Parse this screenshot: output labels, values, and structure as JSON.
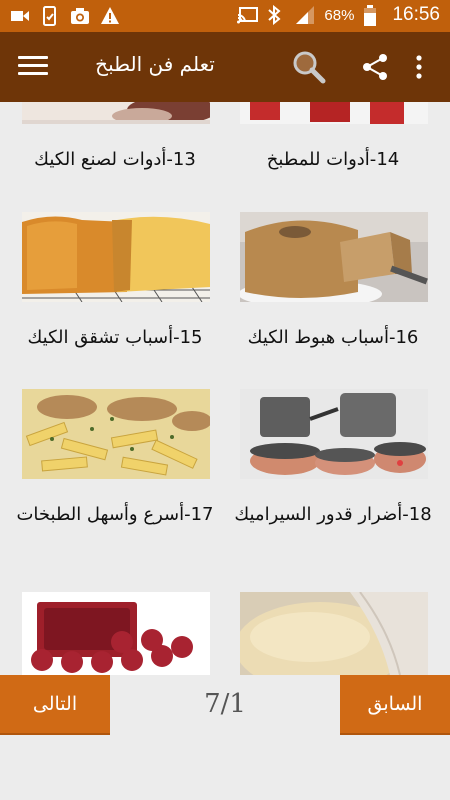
{
  "status_bar": {
    "battery_percent": "68%",
    "time": "16:56",
    "left_icons": [
      "video-icon",
      "phone-check-icon",
      "camera-icon",
      "warning-icon"
    ],
    "right_icons": [
      "cast-icon",
      "bluetooth-icon",
      "signal-icon",
      "battery-icon"
    ]
  },
  "app_bar": {
    "title": "تعلم فن الطبخ",
    "icons": [
      "menu-icon",
      "search-icon",
      "share-icon",
      "more-vert-icon"
    ]
  },
  "grid": {
    "items": [
      {
        "label": "13-أدوات لصنع الكيك"
      },
      {
        "label": "14-أدوات للمطبخ"
      },
      {
        "label": "15-أسباب تشقق الكيك"
      },
      {
        "label": "16-أسباب هبوط الكيك"
      },
      {
        "label": "17-أسرع وأسهل الطبخات"
      },
      {
        "label": "18-أضرار قدور السيراميك"
      }
    ]
  },
  "pagination": {
    "next_label": "التالى",
    "prev_label": "السابق",
    "page_text": "7/1"
  },
  "colors": {
    "status_bar": "#c0600c",
    "app_bar": "#6e3508",
    "button": "#d06a15",
    "background": "#ececec"
  }
}
